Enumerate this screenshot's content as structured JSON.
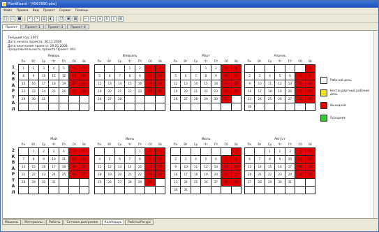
{
  "title": "PlanWizard - [4567890.pbe]",
  "menu": [
    "Файл",
    "Правка",
    "Вид",
    "Проект",
    "Сервис",
    "Помощь"
  ],
  "toolbar": [
    "new-icon",
    "open-icon",
    "save-icon",
    "undo-icon",
    "redo-icon",
    "print-icon",
    "preview-icon",
    "copy-icon",
    "paste-icon",
    "calendar-icon",
    "back-icon",
    "forward-icon",
    "text-a-icon",
    "text-b-icon",
    "text-c-icon",
    "chart-icon"
  ],
  "tabs": [
    "Проект",
    "Проект-1",
    "Проект-3",
    "Проект-4"
  ],
  "info": [
    "Текущий год: 2007",
    "Дата начала проекта: 30.11.2006",
    "Дата окончания проекта: 28.05.2008",
    "Продолжительность проекта Проект: 491"
  ],
  "weekdays": [
    "Пн",
    "Вт",
    "Ср",
    "Чт",
    "Пт",
    "Сб",
    "Вс"
  ],
  "quarters": [
    {
      "label": "1 КВАРТАЛ",
      "letters": [
        "1",
        "К",
        "В",
        "А",
        "Р",
        "Т",
        "А",
        "Л"
      ]
    },
    {
      "label": "2 КВАРТАЛ",
      "letters": [
        "2",
        "К",
        "В",
        "А",
        "Р",
        "Т",
        "А",
        "Л"
      ]
    }
  ],
  "months": [
    {
      "name": "Январь",
      "start": 0,
      "days": 31
    },
    {
      "name": "Февраль",
      "start": 3,
      "days": 28
    },
    {
      "name": "Март",
      "start": 3,
      "days": 31
    },
    {
      "name": "Апрель",
      "start": 6,
      "days": 30
    },
    {
      "name": "Май",
      "start": 1,
      "days": 31
    },
    {
      "name": "Июнь",
      "start": 4,
      "days": 30
    },
    {
      "name": "Июль",
      "start": 6,
      "days": 31
    },
    {
      "name": "Август",
      "start": 2,
      "days": 31
    }
  ],
  "legend": [
    {
      "label": "Рабочий день",
      "color": "#ffffff"
    },
    {
      "label": "Нестандартный рабочий день",
      "color": "#f5e31a"
    },
    {
      "label": "Выходной",
      "color": "#e00000"
    },
    {
      "label": "Праздник",
      "color": "#2ecc2e"
    }
  ],
  "bottom_tabs": [
    "Машины",
    "Материалы",
    "Работы",
    "Сетевая диаграмма",
    "Календарь",
    "Работы/Ресурс"
  ],
  "active_bottom_tab": "Календарь"
}
